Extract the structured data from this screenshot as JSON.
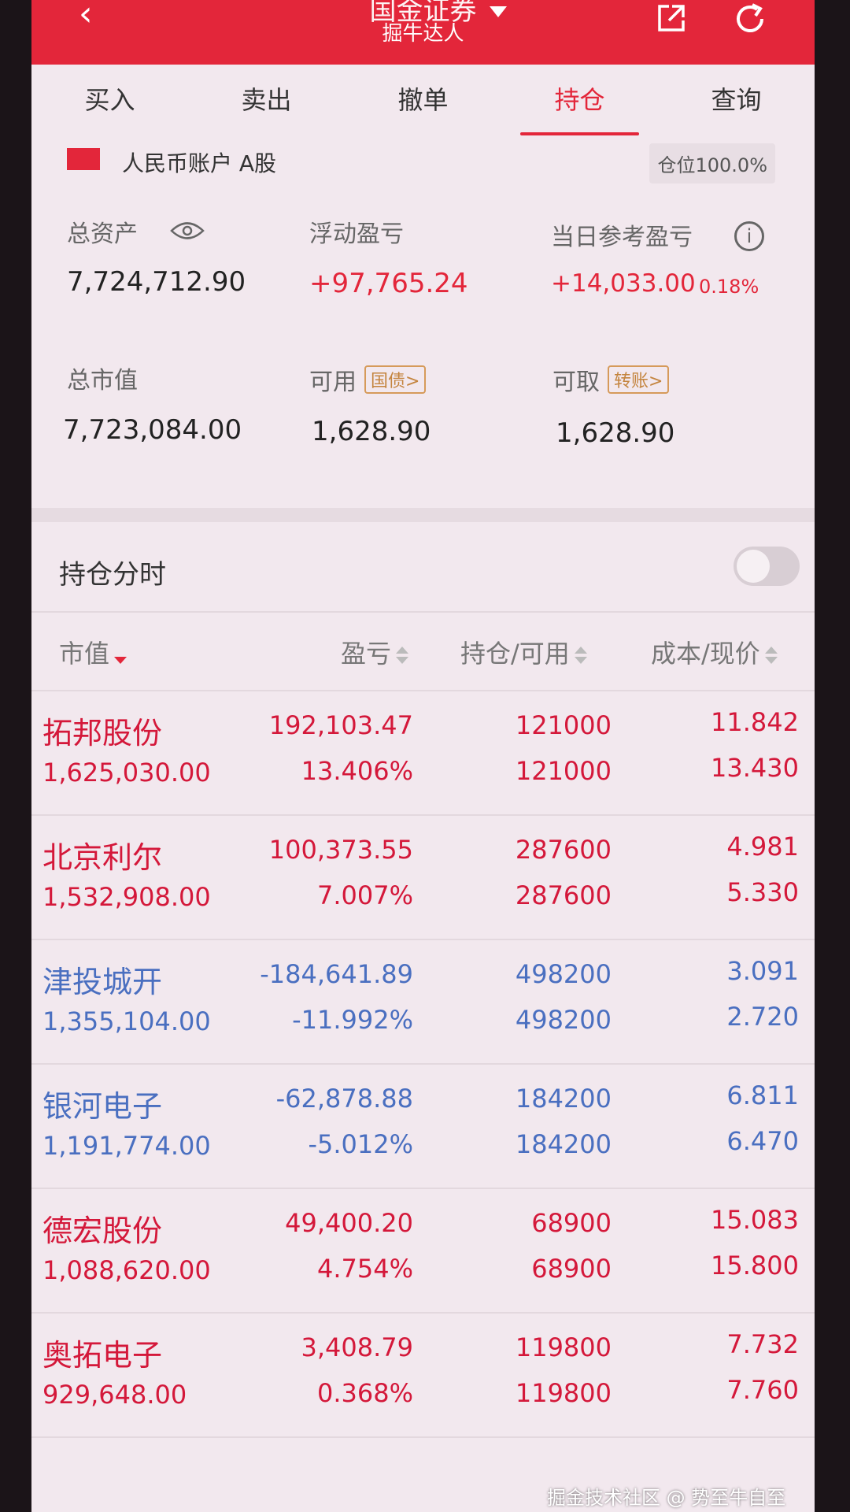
{
  "header": {
    "title": "国金证券",
    "subtitle": "掘牛达人",
    "back_icon": "chevron-left-icon",
    "share_icon": "share-icon",
    "refresh_icon": "refresh-icon"
  },
  "tabs": [
    {
      "label": "买入"
    },
    {
      "label": "卖出"
    },
    {
      "label": "撤单"
    },
    {
      "label": "持仓"
    },
    {
      "label": "查询"
    }
  ],
  "active_tab": "持仓",
  "account": {
    "label": "人民币账户 A股",
    "position_ratio": "仓位100.0%"
  },
  "summary": {
    "total_assets_label": "总资产",
    "total_assets": "7,724,712.90",
    "floating_pl_label": "浮动盈亏",
    "floating_pl": "+97,765.24",
    "daily_pl_label": "当日参考盈亏",
    "daily_pl": "+14,033.00",
    "daily_pl_pct": "0.18%",
    "market_value_label": "总市值",
    "market_value": "7,723,084.00",
    "available_label": "可用",
    "available_tag": "国债>",
    "available": "1,628.90",
    "withdrawable_label": "可取",
    "withdrawable_tag": "转账>",
    "withdrawable": "1,628.90"
  },
  "timeshare": {
    "label": "持仓分时",
    "enabled": false
  },
  "columns": {
    "market_value": "市值",
    "pl": "盈亏",
    "holding": "持仓/可用",
    "cost": "成本/现价"
  },
  "holdings": [
    {
      "name": "拓邦股份",
      "market_value": "1,625,030.00",
      "pl": "192,103.47",
      "pl_pct": "13.406%",
      "holding": "121000",
      "available": "121000",
      "cost": "11.842",
      "price": "13.430",
      "trend": "up"
    },
    {
      "name": "北京利尔",
      "market_value": "1,532,908.00",
      "pl": "100,373.55",
      "pl_pct": "7.007%",
      "holding": "287600",
      "available": "287600",
      "cost": "4.981",
      "price": "5.330",
      "trend": "up"
    },
    {
      "name": "津投城开",
      "market_value": "1,355,104.00",
      "pl": "-184,641.89",
      "pl_pct": "-11.992%",
      "holding": "498200",
      "available": "498200",
      "cost": "3.091",
      "price": "2.720",
      "trend": "down"
    },
    {
      "name": "银河电子",
      "market_value": "1,191,774.00",
      "pl": "-62,878.88",
      "pl_pct": "-5.012%",
      "holding": "184200",
      "available": "184200",
      "cost": "6.811",
      "price": "6.470",
      "trend": "down"
    },
    {
      "name": "德宏股份",
      "market_value": "1,088,620.00",
      "pl": "49,400.20",
      "pl_pct": "4.754%",
      "holding": "68900",
      "available": "68900",
      "cost": "15.083",
      "price": "15.800",
      "trend": "up"
    },
    {
      "name": "奥拓电子",
      "market_value": "929,648.00",
      "pl": "3,408.79",
      "pl_pct": "0.368%",
      "holding": "119800",
      "available": "119800",
      "cost": "7.732",
      "price": "7.760",
      "trend": "up"
    }
  ],
  "watermark": "掘金技术社区 @ 势至牛自至",
  "colors": {
    "brand_red": "#e3263a",
    "gain": "#d4183a",
    "loss": "#4a6fc0",
    "tag_orange": "#c4843e"
  }
}
